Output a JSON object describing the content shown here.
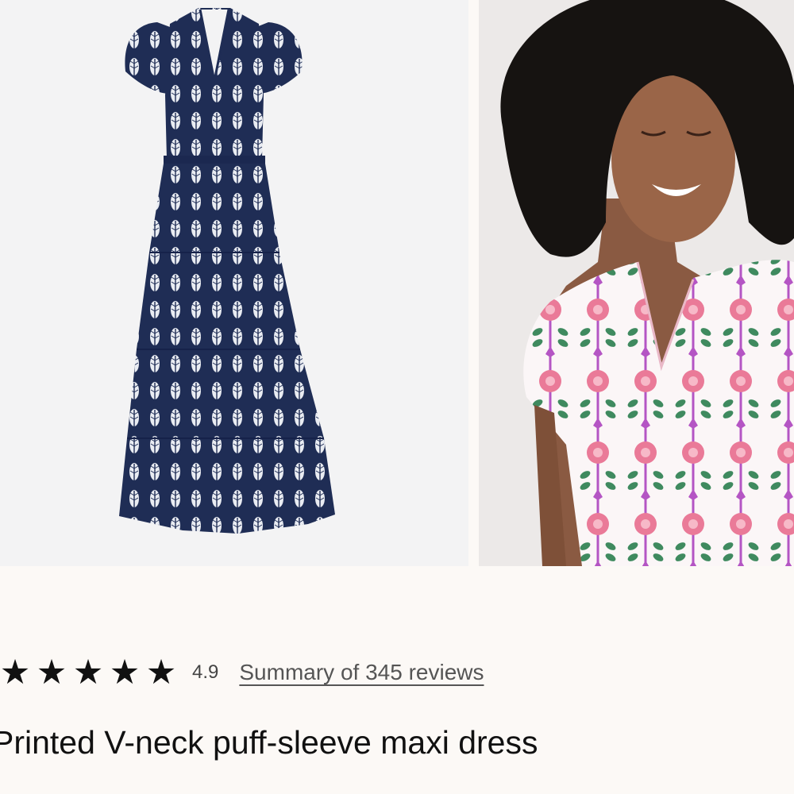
{
  "gallery": {
    "images": [
      {
        "alt": "Navy printed tiered maxi dress product photo",
        "color": "#1f2d55",
        "pattern": "#ffffff"
      },
      {
        "alt": "Model wearing pink and green printed V-neck dress",
        "color": "#ffffff",
        "pattern": "#e56b8e"
      }
    ]
  },
  "rating": {
    "stars": [
      "★",
      "★",
      "★",
      "★",
      "★"
    ],
    "value": "4.9",
    "reviews_link": "Summary of 345 reviews"
  },
  "product": {
    "title": "Printed V-neck puff-sleeve maxi dress"
  }
}
